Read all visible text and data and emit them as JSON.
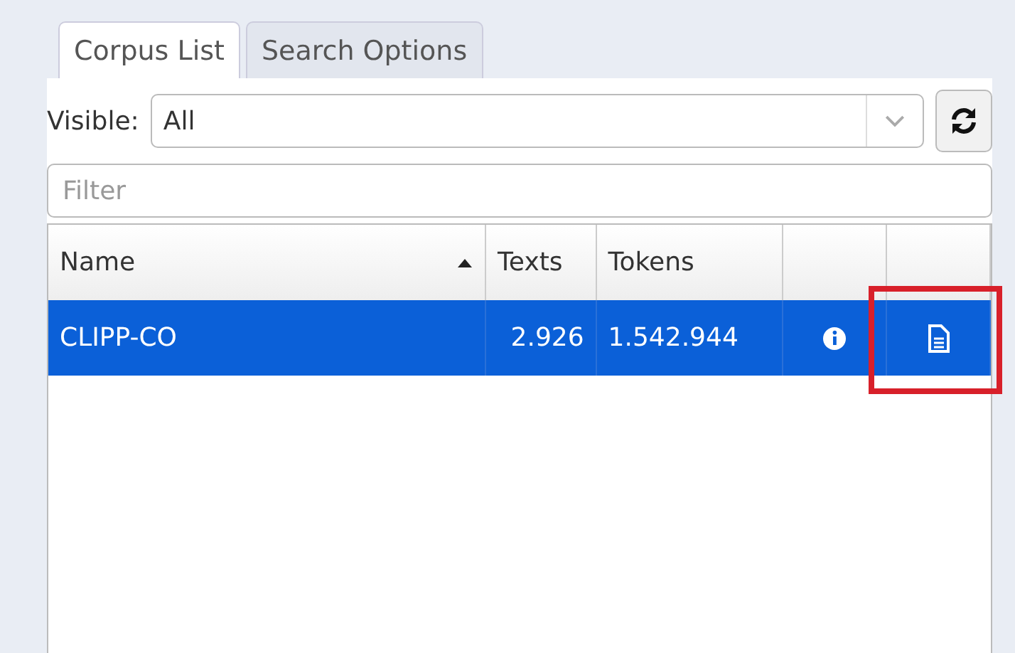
{
  "tabs": [
    {
      "label": "Corpus List",
      "selected": true
    },
    {
      "label": "Search Options",
      "selected": false
    }
  ],
  "visible": {
    "label": "Visible:",
    "value": "All"
  },
  "filter": {
    "placeholder": "Filter"
  },
  "table": {
    "columns": [
      {
        "label": "Name",
        "sorted": true
      },
      {
        "label": "Texts",
        "sorted": false
      },
      {
        "label": "Tokens",
        "sorted": false
      },
      {
        "sorted": false
      },
      {
        "sorted": false
      }
    ],
    "rows": [
      {
        "name": "CLIPP-CO",
        "texts": "2.926",
        "tokens": "1.542.944",
        "selected": true,
        "document_highlighted": true
      }
    ]
  }
}
